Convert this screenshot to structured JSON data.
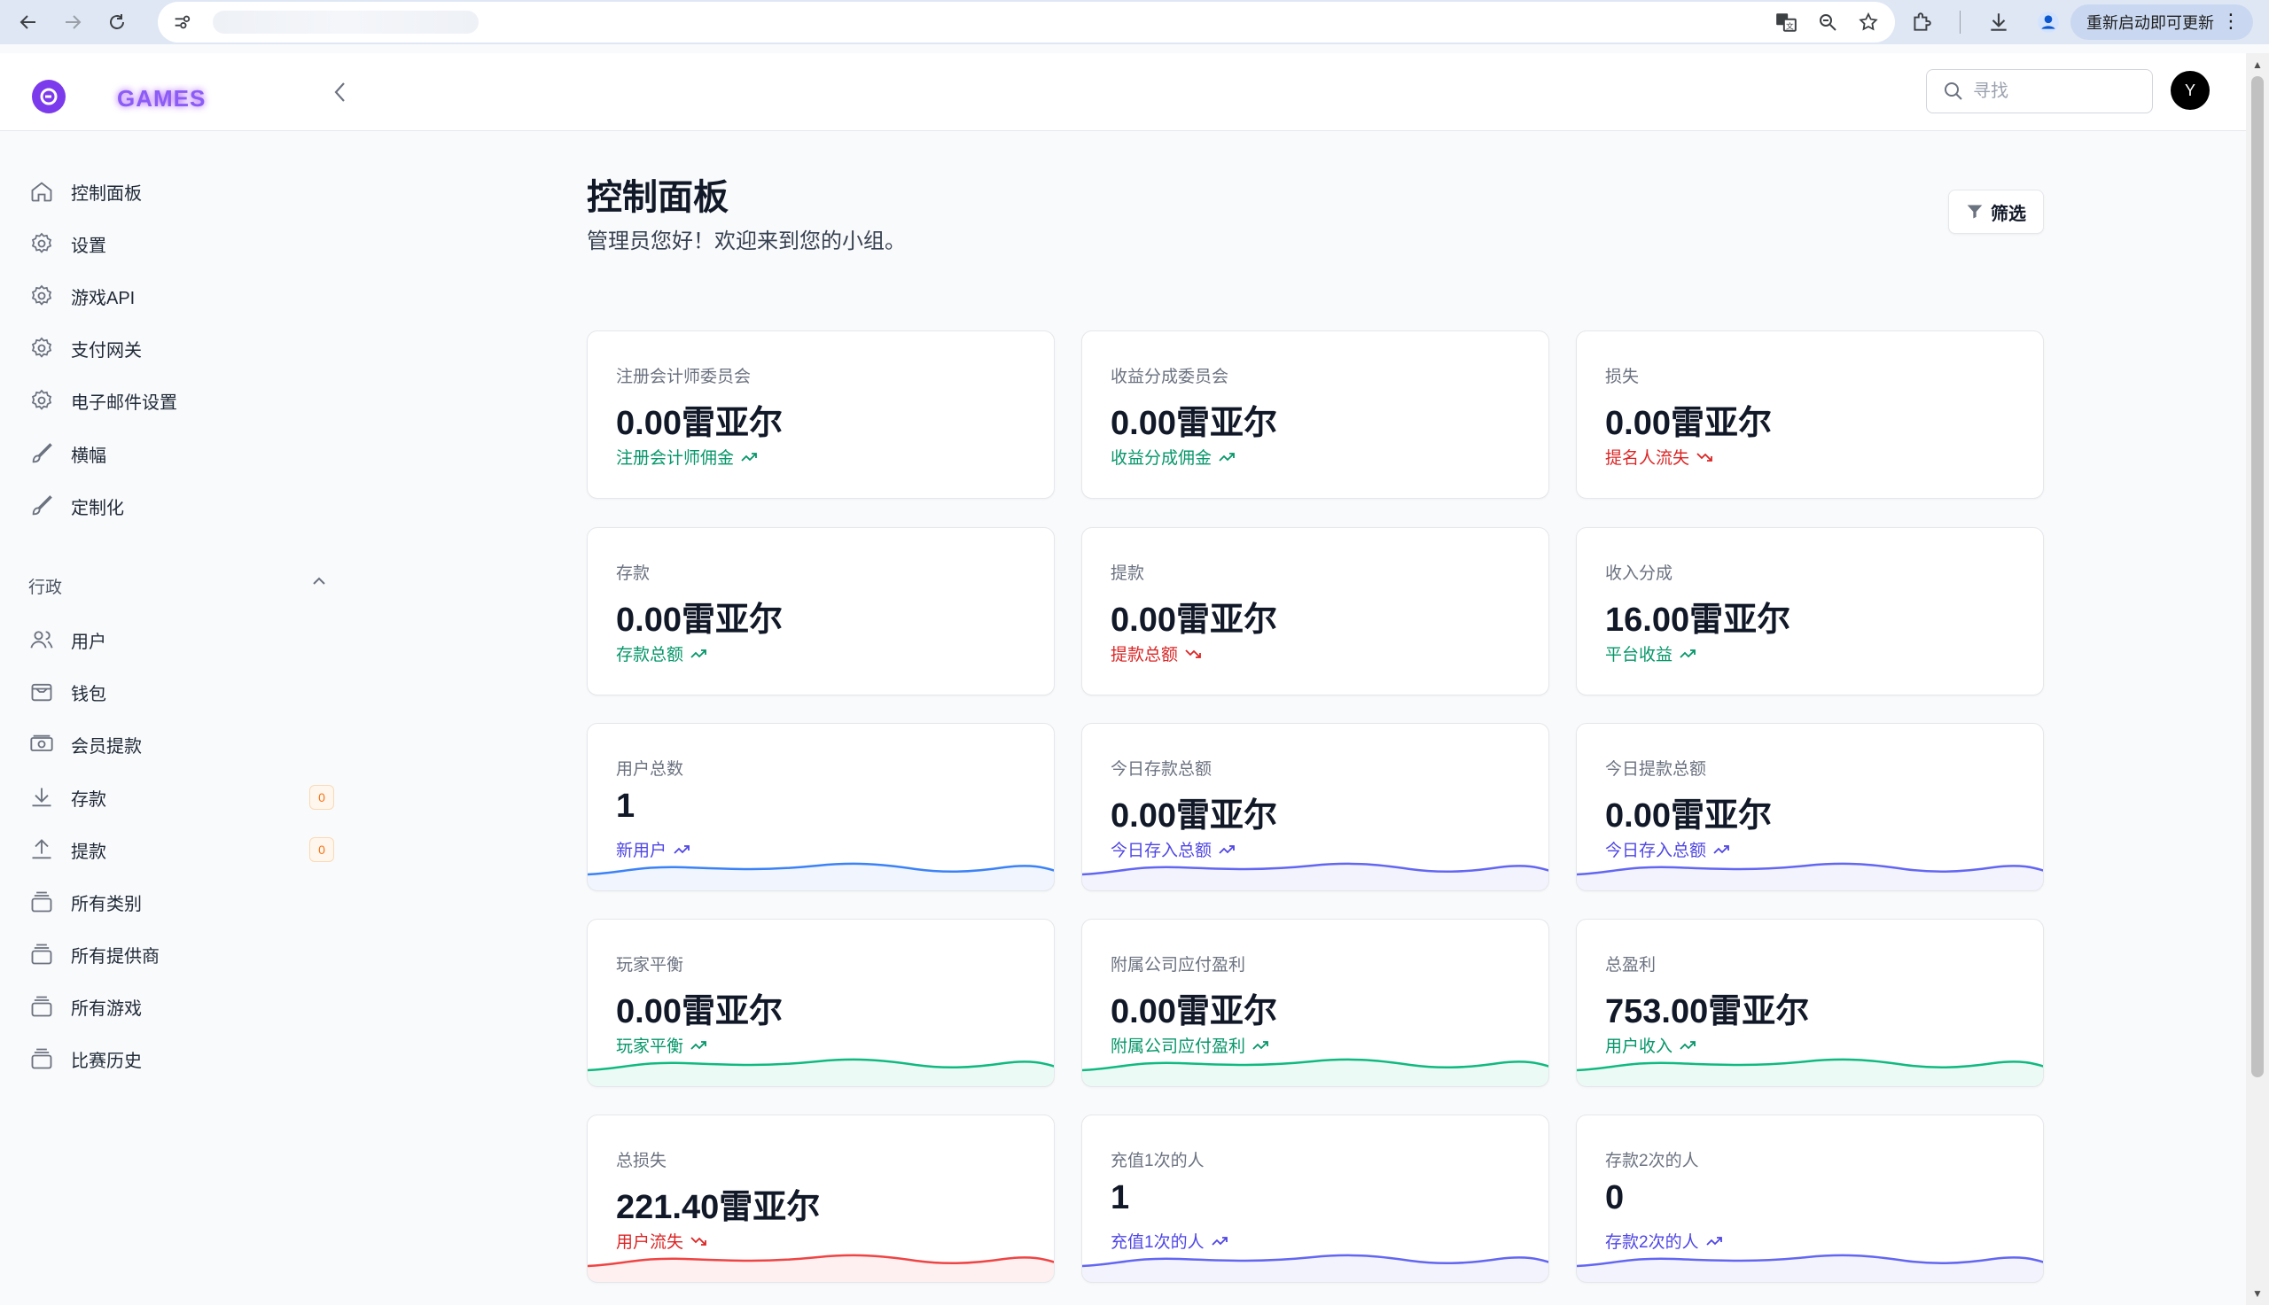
{
  "browser": {
    "update_label": "重新启动即可更新",
    "menu_glyph": "⋮"
  },
  "app": {
    "brand": "GAMES",
    "search_placeholder": "寻找",
    "avatar_initial": "Y",
    "accent": "#7c3aed"
  },
  "sidebar": {
    "items": [
      {
        "label": "控制面板",
        "icon": "home-icon"
      },
      {
        "label": "设置",
        "icon": "gear-icon"
      },
      {
        "label": "游戏API",
        "icon": "gear-icon"
      },
      {
        "label": "支付网关",
        "icon": "gear-icon"
      },
      {
        "label": "电子邮件设置",
        "icon": "gear-icon"
      },
      {
        "label": "横幅",
        "icon": "brush-icon"
      },
      {
        "label": "定制化",
        "icon": "brush-icon"
      }
    ],
    "section_label": "行政",
    "admin_items": [
      {
        "label": "用户",
        "icon": "users-icon"
      },
      {
        "label": "钱包",
        "icon": "wallet-icon"
      },
      {
        "label": "会员提款",
        "icon": "cash-icon"
      },
      {
        "label": "存款",
        "icon": "download-icon",
        "badge": "0"
      },
      {
        "label": "提款",
        "icon": "upload-icon",
        "badge": "0"
      },
      {
        "label": "所有类别",
        "icon": "stack-icon"
      },
      {
        "label": "所有提供商",
        "icon": "stack-icon"
      },
      {
        "label": "所有游戏",
        "icon": "stack-icon"
      },
      {
        "label": "比赛历史",
        "icon": "stack-icon"
      }
    ]
  },
  "main": {
    "title": "控制面板",
    "subtitle": "管理员您好！欢迎来到您的小组。",
    "filter_label": "筛选",
    "colors": {
      "green": "#059669",
      "red": "#dc2626",
      "blue": "#4f46e5",
      "line_blue": "#3b82f6",
      "line_indigo": "#6366f1",
      "line_green": "#10b981",
      "line_red": "#ef4444"
    },
    "cards": [
      {
        "label": "注册会计师委员会",
        "value": "0.00雷亚尔",
        "trend": "注册会计师佣金",
        "tone": "green",
        "dir": "up",
        "spark": null
      },
      {
        "label": "收益分成委员会",
        "value": "0.00雷亚尔",
        "trend": "收益分成佣金",
        "tone": "green",
        "dir": "up",
        "spark": null
      },
      {
        "label": "损失",
        "value": "0.00雷亚尔",
        "trend": "提名人流失",
        "tone": "red",
        "dir": "down",
        "spark": null
      },
      {
        "label": "存款",
        "value": "0.00雷亚尔",
        "trend": "存款总额",
        "tone": "green",
        "dir": "up",
        "spark": null
      },
      {
        "label": "提款",
        "value": "0.00雷亚尔",
        "trend": "提款总额",
        "tone": "red",
        "dir": "down",
        "spark": null
      },
      {
        "label": "收入分成",
        "value": "16.00雷亚尔",
        "trend": "平台收益",
        "tone": "green",
        "dir": "up",
        "spark": null
      },
      {
        "label": "用户总数",
        "value": "1",
        "trend": "新用户",
        "tone": "blue",
        "dir": "up",
        "spark": "line_blue"
      },
      {
        "label": "今日存款总额",
        "value": "0.00雷亚尔",
        "trend": "今日存入总额",
        "tone": "blue",
        "dir": "up",
        "spark": "line_indigo"
      },
      {
        "label": "今日提款总额",
        "value": "0.00雷亚尔",
        "trend": "今日存入总额",
        "tone": "blue",
        "dir": "up",
        "spark": "line_indigo"
      },
      {
        "label": "玩家平衡",
        "value": "0.00雷亚尔",
        "trend": "玩家平衡",
        "tone": "green",
        "dir": "up",
        "spark": "line_green"
      },
      {
        "label": "附属公司应付盈利",
        "value": "0.00雷亚尔",
        "trend": "附属公司应付盈利",
        "tone": "green",
        "dir": "up",
        "spark": "line_green"
      },
      {
        "label": "总盈利",
        "value": "753.00雷亚尔",
        "trend": "用户收入",
        "tone": "green",
        "dir": "up",
        "spark": "line_green"
      },
      {
        "label": "总损失",
        "value": "221.40雷亚尔",
        "trend": "用户流失",
        "tone": "red",
        "dir": "down",
        "spark": "line_red"
      },
      {
        "label": "充值1次的人",
        "value": "1",
        "trend": "充值1次的人",
        "tone": "blue",
        "dir": "up",
        "spark": "line_indigo"
      },
      {
        "label": "存款2次的人",
        "value": "0",
        "trend": "存款2次的人",
        "tone": "blue",
        "dir": "up",
        "spark": "line_indigo"
      }
    ]
  }
}
